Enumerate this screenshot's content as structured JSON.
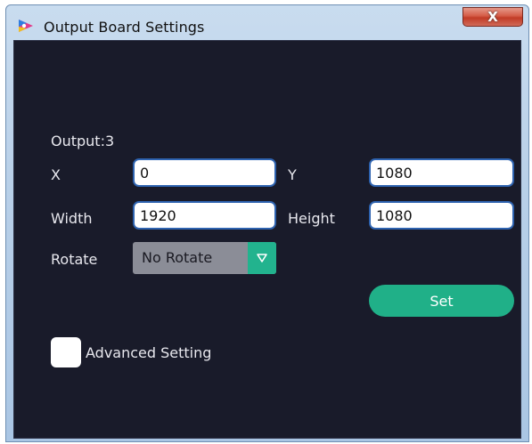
{
  "window": {
    "title": "Output Board Settings",
    "close_glyph": "X",
    "icon": "app-logo-icon"
  },
  "form": {
    "output_label": "Output:3",
    "x_label": "X",
    "x_value": "0",
    "y_label": "Y",
    "y_value": "1080",
    "width_label": "Width",
    "width_value": "1920",
    "height_label": "Height",
    "height_value": "1080",
    "rotate_label": "Rotate",
    "rotate_value": "No Rotate",
    "set_label": "Set",
    "advanced_label": "Advanced Setting",
    "advanced_checked": false
  },
  "colors": {
    "client_bg": "#191b2a",
    "accent": "#20b088",
    "input_border": "#2e63b0"
  }
}
